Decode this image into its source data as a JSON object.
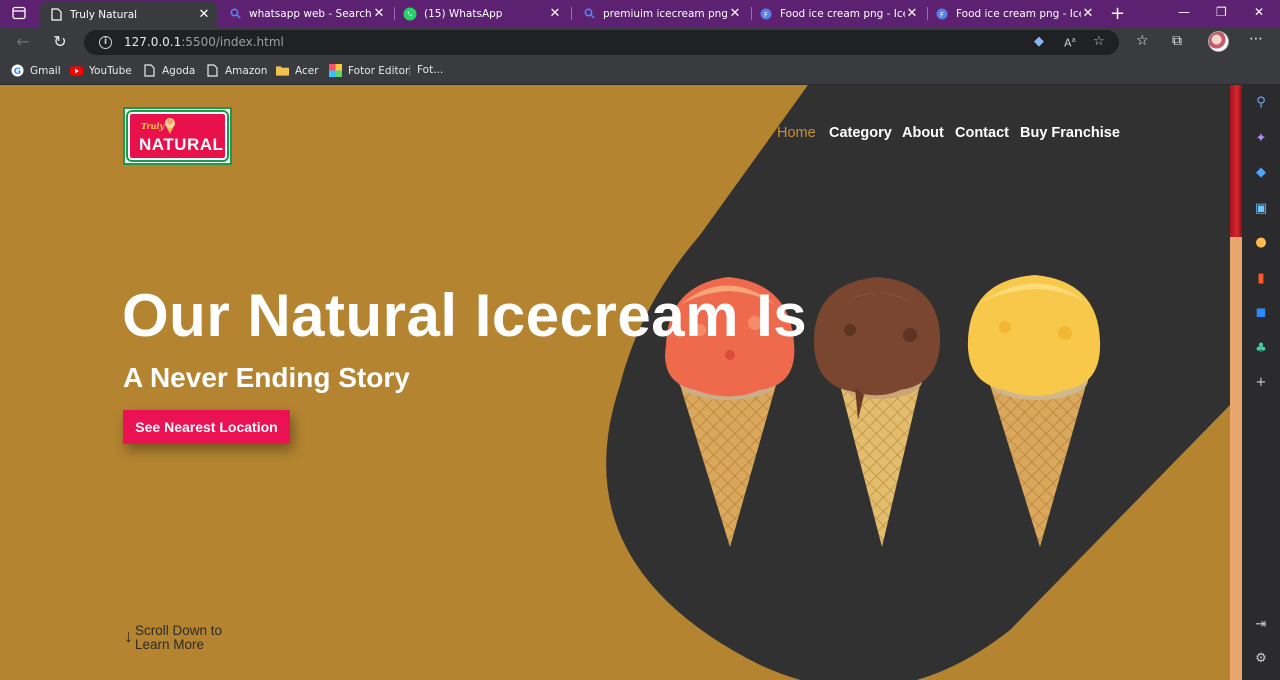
{
  "browser": {
    "tabs": [
      {
        "title": "Truly Natural",
        "active": true,
        "icon": "page-icon"
      },
      {
        "title": "whatsapp web - Search",
        "active": false,
        "icon": "search-icon"
      },
      {
        "title": "(15) WhatsApp",
        "active": false,
        "icon": "whatsapp-icon"
      },
      {
        "title": "premiuim icecream png - Se",
        "active": false,
        "icon": "search-icon"
      },
      {
        "title": "Food ice cream png - Ice Cr",
        "active": false,
        "icon": "freepik-icon"
      },
      {
        "title": "Food ice cream png - Ice Cr",
        "active": false,
        "icon": "freepik-icon"
      }
    ],
    "url_host": "127.0.0.1",
    "url_rest": ":5500/index.html",
    "bookmarks": [
      {
        "label": "Gmail",
        "icon": "google-icon"
      },
      {
        "label": "YouTube",
        "icon": "youtube-icon"
      },
      {
        "label": "Agoda",
        "icon": "page-icon"
      },
      {
        "label": "Amazon",
        "icon": "page-icon"
      },
      {
        "label": "Acer",
        "icon": "folder-icon"
      },
      {
        "label": "Fotor Editor",
        "icon": "fotor-icon"
      },
      {
        "label": "Fot...",
        "icon": "page-icon"
      }
    ]
  },
  "site": {
    "logo_top": "Truly",
    "logo_main": "NATURAL",
    "nav": [
      "Home",
      "Category",
      "About",
      "Contact",
      "Buy Franchise"
    ],
    "hero_title": "Our Natural Icecream Is",
    "hero_subtitle": "A Never Ending Story",
    "cta_label": "See Nearest Location",
    "scroll_hint_line1": "Scroll Down to",
    "scroll_hint_line2": "Learn More"
  },
  "colors": {
    "page_bg": "#b48430",
    "dark_shape": "#323132",
    "accent": "#ea1252",
    "nav_active": "#c69233",
    "tab_strip": "#5c2170"
  }
}
